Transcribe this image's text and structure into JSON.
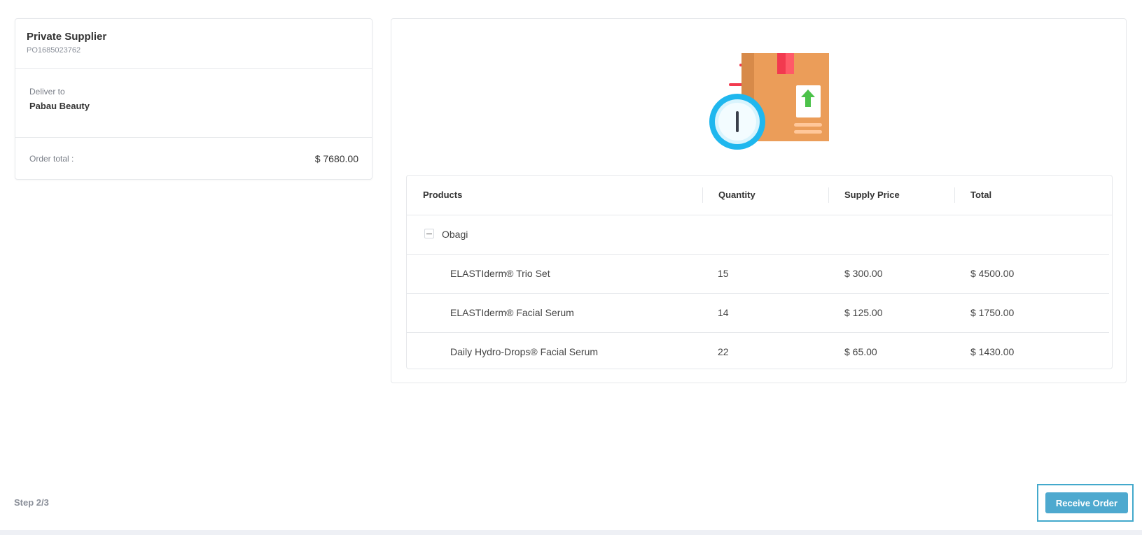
{
  "summary": {
    "supplier_name": "Private Supplier",
    "po_number": "PO1685023762",
    "deliver_label": "Deliver to",
    "deliver_value": "Pabau Beauty",
    "order_total_label": "Order total :",
    "order_total_value": "$ 7680.00"
  },
  "illustration": {
    "icon": "package-clock-icon",
    "colors": {
      "box": "#eb9d59",
      "tape": "#f23a4f",
      "arrow": "#4cc24a",
      "clock": "#1fb7ee"
    }
  },
  "table": {
    "headers": [
      "Products",
      "Quantity",
      "Supply Price",
      "Total"
    ],
    "group": {
      "label": "Obagi",
      "collapse_icon": "minus-icon"
    },
    "rows": [
      {
        "product": "ELASTIderm® Trio Set",
        "quantity": "15",
        "supply_price": "$ 300.00",
        "total": "$ 4500.00"
      },
      {
        "product": "ELASTIderm® Facial Serum",
        "quantity": "14",
        "supply_price": "$ 125.00",
        "total": "$ 1750.00"
      },
      {
        "product": "Daily Hydro-Drops® Facial Serum",
        "quantity": "22",
        "supply_price": "$ 65.00",
        "total": "$ 1430.00"
      }
    ]
  },
  "footer": {
    "step": "Step 2/3",
    "receive_button": "Receive Order"
  },
  "colors": {
    "accent": "#4ea9cf",
    "border": "#e6e8eb"
  }
}
